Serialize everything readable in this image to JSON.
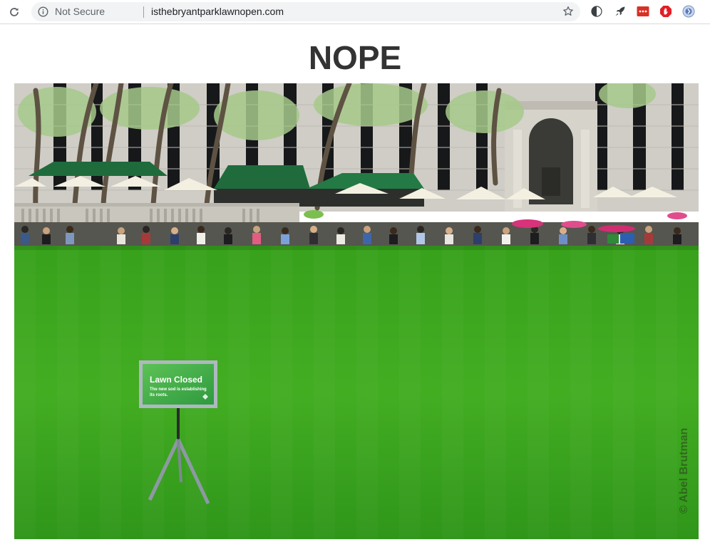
{
  "browser": {
    "security_label": "Not Secure",
    "url": "isthebryantparklawnopen.com"
  },
  "page": {
    "headline": "NOPE",
    "photo": {
      "sign_title": "Lawn Closed",
      "sign_line1": "The new sod is establishing",
      "sign_line2": "its roots.",
      "credit": "© Abel Brutman"
    }
  },
  "colors": {
    "lawn": "#3fa821",
    "sign_green": "#4cb847",
    "awning_green": "#1f6b3c",
    "headline": "#333333"
  },
  "icons": [
    "reload-icon",
    "info-icon",
    "star-icon",
    "half-moon-extension-icon",
    "rocket-extension-icon",
    "red-dots-extension-icon",
    "adblock-extension-icon",
    "globe-extension-icon"
  ]
}
